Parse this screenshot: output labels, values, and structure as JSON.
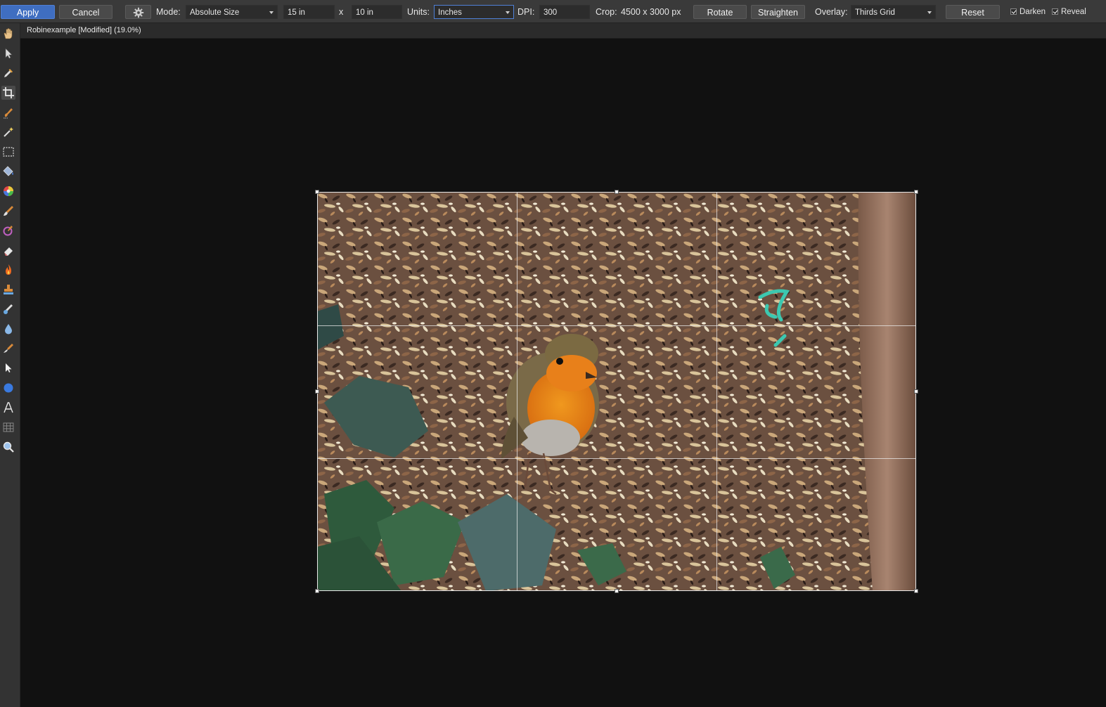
{
  "toolbar": {
    "apply_label": "Apply",
    "cancel_label": "Cancel",
    "settings_icon": "gear-icon",
    "mode_label": "Mode:",
    "mode_value": "Absolute Size",
    "width_value": "15 in",
    "times_label": "x",
    "height_value": "10 in",
    "units_label": "Units:",
    "units_value": "Inches",
    "dpi_label": "DPI:",
    "dpi_value": "300",
    "crop_label": "Crop:",
    "crop_value": "4500 x 3000 px",
    "rotate_label": "Rotate",
    "straighten_label": "Straighten",
    "overlay_label": "Overlay:",
    "overlay_value": "Thirds Grid",
    "reset_label": "Reset",
    "darken_label": "Darken",
    "darken_checked": true,
    "reveal_label": "Reveal",
    "reveal_checked": true
  },
  "document": {
    "tab_title": "Robinexample [Modified] (19.0%)"
  },
  "tools": [
    {
      "name": "view-tool",
      "icon": "hand-icon"
    },
    {
      "name": "move-tool",
      "icon": "arrow-pointer-icon"
    },
    {
      "name": "color-picker-tool",
      "icon": "eyedropper-icon"
    },
    {
      "name": "crop-tool",
      "icon": "crop-icon",
      "active": true
    },
    {
      "name": "selection-brush-tool",
      "icon": "selection-brush-icon"
    },
    {
      "name": "flood-select-tool",
      "icon": "magic-wand-icon"
    },
    {
      "name": "marquee-tool",
      "icon": "rectangle-marquee-icon"
    },
    {
      "name": "flood-fill-tool",
      "icon": "paint-bucket-icon"
    },
    {
      "name": "gradient-tool",
      "icon": "color-wheel-icon"
    },
    {
      "name": "paint-brush-tool",
      "icon": "paint-brush-icon"
    },
    {
      "name": "color-replacement-tool",
      "icon": "color-replace-brush-icon"
    },
    {
      "name": "erase-brush-tool",
      "icon": "eraser-icon"
    },
    {
      "name": "dodge-tool",
      "icon": "flame-icon"
    },
    {
      "name": "clone-tool",
      "icon": "clone-stamp-icon"
    },
    {
      "name": "healing-brush-tool",
      "icon": "healing-brush-icon"
    },
    {
      "name": "blur-tool",
      "icon": "water-drop-icon"
    },
    {
      "name": "smudge-tool",
      "icon": "smudge-brush-icon"
    },
    {
      "name": "node-tool",
      "icon": "node-pointer-icon"
    },
    {
      "name": "shape-tool",
      "icon": "ellipse-shape-icon"
    },
    {
      "name": "text-tool",
      "icon": "text-a-icon"
    },
    {
      "name": "mesh-warp-tool",
      "icon": "mesh-grid-icon"
    },
    {
      "name": "zoom-tool",
      "icon": "magnifier-icon"
    }
  ],
  "canvas": {
    "overlay": "thirds-grid",
    "photo_subject": "robin-on-woodchips"
  }
}
